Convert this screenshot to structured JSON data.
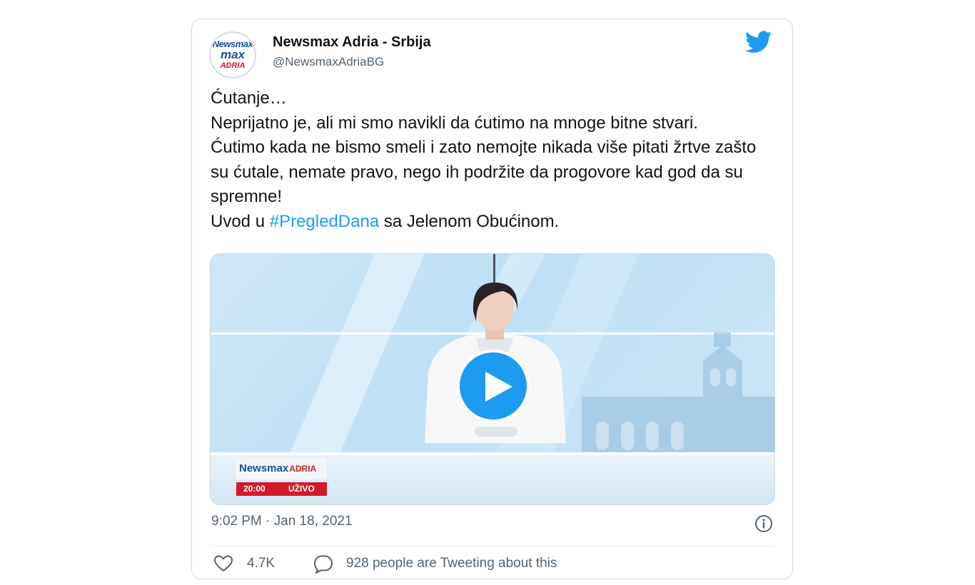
{
  "author": {
    "name": "Newsmax Adria - Srbija",
    "handle": "@NewsmaxAdriaBG",
    "avatar_lines": [
      "Newsmax",
      "max",
      "ADRIA"
    ]
  },
  "tweet": {
    "lines": [
      "Ćutanje…",
      "Neprijatno je, ali mi smo navikli da ćutimo na mnoge bitne stvari.",
      "Ćutimo kada ne bismo smeli i zato nemojte nikada više pitati žrtve zašto su ćutale, nemate pravo, nego ih podržite da progovore kad god da su spremne!"
    ],
    "last_line": {
      "before": "Uvod u ",
      "hashtag": "#PregledDana",
      "after": " sa Jelenom Obućinom."
    }
  },
  "media": {
    "type": "video",
    "lower_third": {
      "brand_a": "Newsmax",
      "brand_b": "ADRIA",
      "time": "20:00",
      "live": "UŽIVO"
    }
  },
  "meta": {
    "timestamp": "9:02 PM · Jan 18, 2021"
  },
  "actions": {
    "likes": "4.7K",
    "tweeting": "928 people are Tweeting about this"
  },
  "colors": {
    "accent": "#1d9bf0",
    "text": "#0f1419",
    "muted": "#536471",
    "border": "#cfd9de",
    "brand_red": "#d01c28",
    "brand_blue": "#1d4e9e"
  },
  "icons": [
    "twitter-bird-icon",
    "play-icon",
    "info-icon",
    "heart-icon",
    "comment-bubble-icon"
  ]
}
